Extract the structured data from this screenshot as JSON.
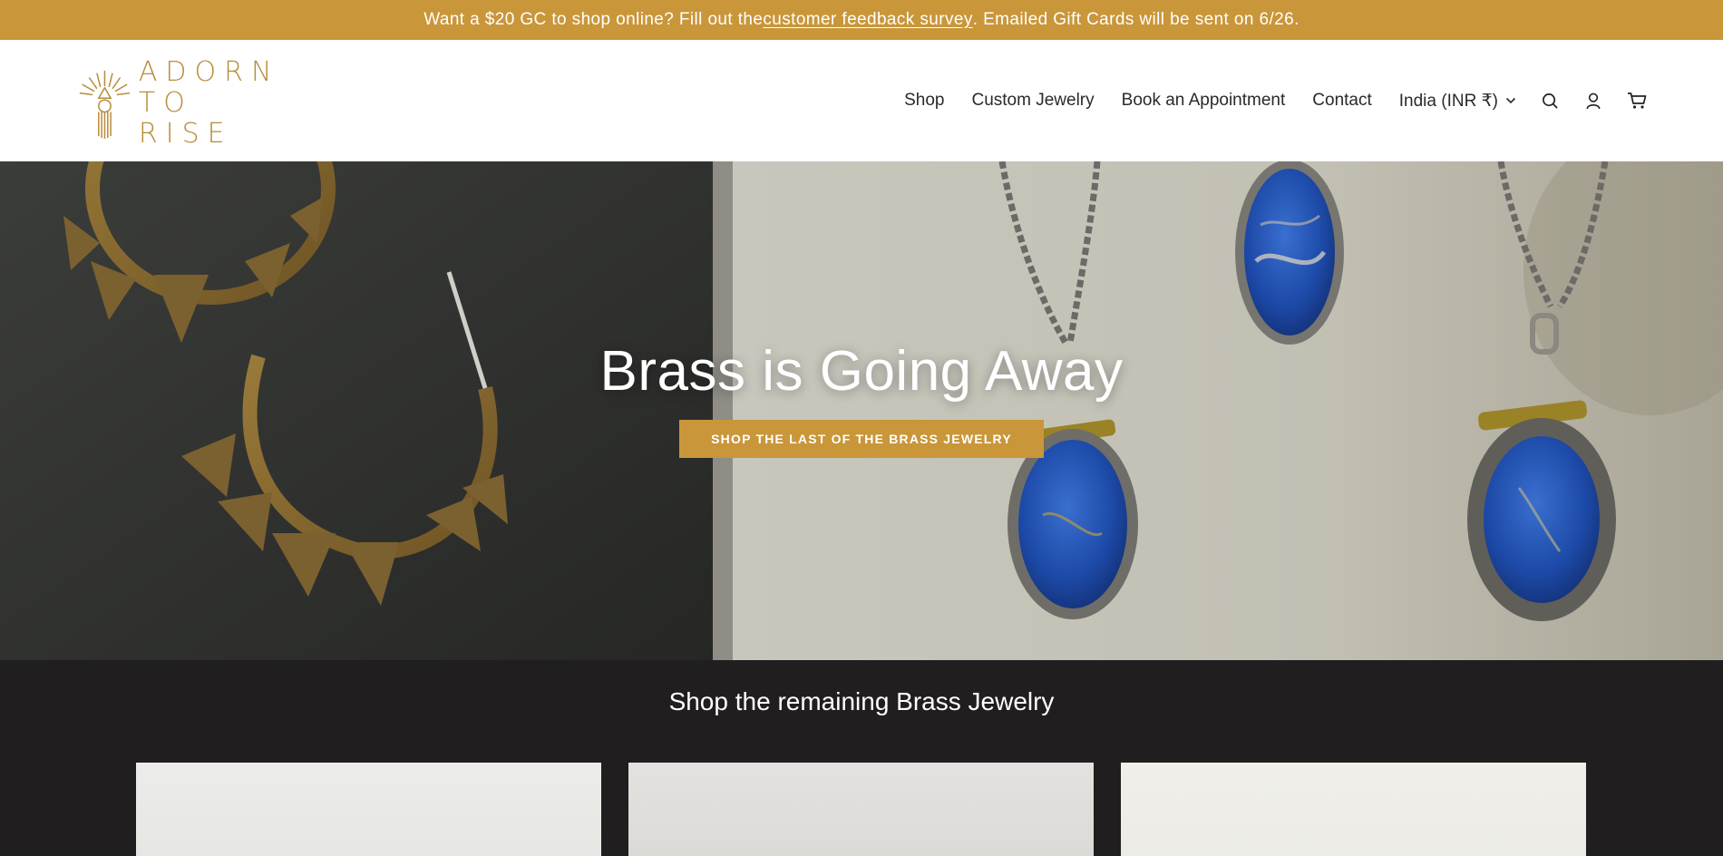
{
  "announcement": {
    "prefix": "Want a $20 GC to shop online? Fill out the ",
    "link": "customer feedback survey",
    "suffix": ". Emailed Gift Cards will be sent on 6/26."
  },
  "brand": {
    "line1": "ADORN",
    "line2": "TO RISE",
    "color": "#b88d3a"
  },
  "nav": {
    "items": [
      "Shop",
      "Custom Jewelry",
      "Book an Appointment",
      "Contact"
    ],
    "country": "India (INR ₹)",
    "icons": [
      "search-icon",
      "account-icon",
      "cart-icon"
    ]
  },
  "hero": {
    "title": "Brass is Going Away",
    "button": "SHOP THE LAST OF THE BRASS JEWELRY"
  },
  "collection": {
    "title": "Shop the remaining Brass Jewelry"
  },
  "colors": {
    "accent": "#c9963a",
    "dark": "#211e1f"
  }
}
